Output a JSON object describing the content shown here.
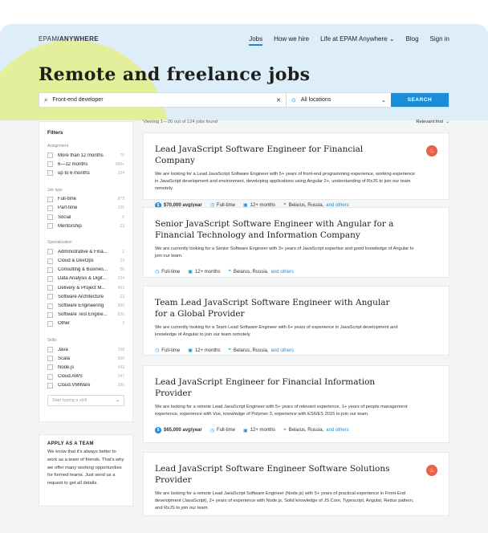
{
  "nav": {
    "logo_brand": "EPAM",
    "logo_sep": "/",
    "logo_sub": "ANYWHERE",
    "links": [
      "Jobs",
      "How we hire",
      "Life at EPAM Anywhere",
      "Blog",
      "Sign in"
    ],
    "life_chevron": "⌄"
  },
  "page_title": "Remote and freelance jobs",
  "search": {
    "query": "Front-end developer",
    "clear": "✕",
    "location": "All locations",
    "button": "SEARCH"
  },
  "filters": {
    "title": "Filters",
    "groups": [
      {
        "title": "Assignment",
        "items": [
          {
            "label": "More than 12 months",
            "count": "75"
          },
          {
            "label": "6—12 months",
            "count": "999+"
          },
          {
            "label": "up to 6 months",
            "count": "234"
          }
        ]
      },
      {
        "title": "Job type",
        "items": [
          {
            "label": "Full-time",
            "count": "873"
          },
          {
            "label": "Part-time",
            "count": "125"
          },
          {
            "label": "Social",
            "count": "5"
          },
          {
            "label": "Mentorship",
            "count": "23"
          }
        ]
      },
      {
        "title": "Specialization",
        "items": [
          {
            "label": "Administrative & Fina...",
            "count": "1"
          },
          {
            "label": "Cloud & DevOps",
            "count": "23"
          },
          {
            "label": "Consulting & Busines...",
            "count": "56"
          },
          {
            "label": "Data Analysis & Digit...",
            "count": "234"
          },
          {
            "label": "Delivery & Project M...",
            "count": "453"
          },
          {
            "label": "Software Architecture",
            "count": "23"
          },
          {
            "label": "Software Engineering",
            "count": "900"
          },
          {
            "label": "Software Test Engine...",
            "count": "830"
          },
          {
            "label": "Other",
            "count": "3"
          }
        ]
      },
      {
        "title": "Skills",
        "items": [
          {
            "label": "Java",
            "count": "708"
          },
          {
            "label": "Scala",
            "count": "650"
          },
          {
            "label": "Node.js",
            "count": "542"
          },
          {
            "label": "Cloud.AWS",
            "count": "147"
          },
          {
            "label": "Cloud.VMWare",
            "count": "290"
          }
        ]
      }
    ],
    "skill_placeholder": "Start typing a skill"
  },
  "team": {
    "heading": "APPLY AS A TEAM",
    "text": "We know that it's always better to work as a team of friends. That's why we offer many working opportunities for formed teams. Just send us a request to get all details."
  },
  "results": {
    "viewing": "Viewing 1—20 out of 124 jobs found",
    "sort": "Relevant first"
  },
  "jobs": [
    {
      "title": "Lead JavaScript Software Engineer for Financial Company",
      "desc": "We are looking for a Lead JavaScript Software Engineer with 5+ years of front-end programming experience, working experience in JavaScript development and environment, developing applications using Angular 2+, understanding of RxJS to join our team remotely.",
      "salary": "$70,000 avg/year",
      "type": "Full-time",
      "duration": "12+ months",
      "locations": "Belarus, Russia,",
      "others": "and others",
      "hot": true
    },
    {
      "title": "Senior JavaScript Software Engineer with Angular for a Financial Technology and Information Company",
      "desc": "We are currently looking for a Senior Software Engineer with 3+ years of JavaScript expertise and good knowledge of Angular to join our team.",
      "salary": "",
      "type": "Full-time",
      "duration": "12+ months",
      "locations": "Belarus, Russia,",
      "others": "and others",
      "hot": false
    },
    {
      "title": "Team Lead JavaScript Software Engineer with Angular for a Global Provider",
      "desc": "We are currently looking for a  Team Lead Software Engineer with 6+ years of experience in JavaScript development and knowledge of Angular to join our team remotely.",
      "salary": "",
      "type": "Full-time",
      "duration": "12+ months",
      "locations": "Belarus, Russia,",
      "others": "and others",
      "hot": false
    },
    {
      "title": "Lead JavaScript Engineer for Financial Information Provider",
      "desc": "We are looking for a remote Lead JavaScript Engineer with 5+ years of relevant experience, 1+ years of people management experience, experience with Vue, knowledge of Polymer 3, experience with ES6/ES 2015 to join our team.",
      "salary": "$65,000 avg/year",
      "type": "Full-time",
      "duration": "12+ months",
      "locations": "Belarus, Russia,",
      "others": "and others",
      "hot": false
    },
    {
      "title": "Lead JavaScript Software Engineer Software Solutions Provider",
      "desc": "We are looking for a remote Lead JavaScript Software Engineer (Node.js) with 5+ years of practical experience in Front-End development (JavaScript), 2+ years of experience with Node.js, Solid knowledge of JS Core, Typescript, Angular, Redux pattern, and RxJS to join our team.",
      "salary": "",
      "type": "",
      "duration": "",
      "locations": "",
      "others": "",
      "hot": true
    }
  ],
  "icons": {
    "search": "⌕",
    "location": "⊙",
    "chevron": "⌄",
    "salary": "$",
    "clock": "◷",
    "calendar": "▣",
    "pin": "⌖",
    "fire": "♨"
  },
  "colors": {
    "accent": "#1a8cd8",
    "hero_bg": "#ddeef8",
    "blob": "#e3ef9a",
    "hot": "#e8624a"
  }
}
